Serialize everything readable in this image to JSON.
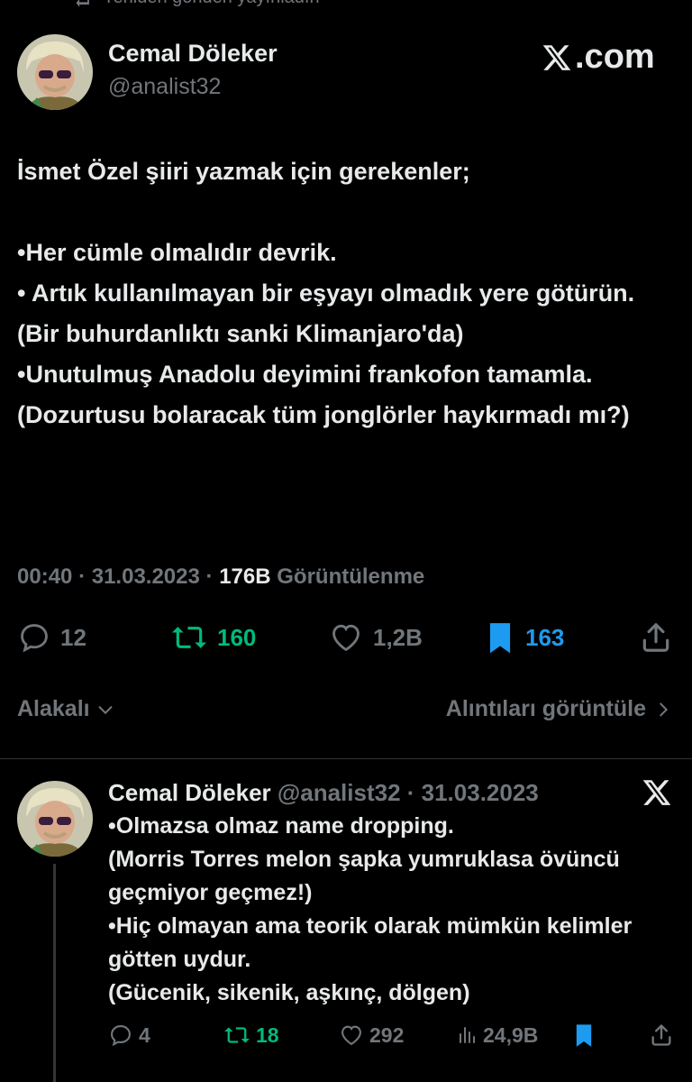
{
  "repost_notice": "Yeniden gönderi yayınladın",
  "branding": {
    "site": ".com"
  },
  "tweet": {
    "author_name": "Cemal Döleker",
    "author_handle": "@analist32",
    "lines": [
      "İsmet Özel şiiri yazmak için gerekenler;",
      "",
      "•Her cümle olmalıdır devrik.",
      "• Artık kullanılmayan bir eşyayı olmadık yere götürün. (Bir buhurdanlıktı sanki Klimanjaro'da)",
      "•Unutulmuş Anadolu deyimini frankofon tamamla. (Dozurtusu bolaracak tüm jonglörler haykırmadı mı?)"
    ],
    "time": "00:40",
    "date": "31.03.2023",
    "views_count": "176B",
    "views_label": "Görüntülenme",
    "replies": "12",
    "reposts": "160",
    "likes": "1,2B",
    "bookmarks": "163"
  },
  "subbar": {
    "sort_label": "Alakalı",
    "quotes_label": "Alıntıları görüntüle"
  },
  "reply": {
    "author_name": "Cemal Döleker",
    "author_handle": "@analist32",
    "date": "31.03.2023",
    "lines": [
      "•Olmazsa olmaz name dropping.",
      "(Morris Torres melon şapka yumruklasa övüncü geçmiyor geçmez!)",
      "•Hiç olmayan ama teorik olarak mümkün kelimler götten uydur.",
      "(Gücenik, sikenik, aşkınç, dölgen)"
    ],
    "replies": "4",
    "reposts": "18",
    "likes": "292",
    "views": "24,9B"
  },
  "colors": {
    "background": "#000000",
    "text": "#e7e9ea",
    "muted": "#71767b",
    "repost_green": "#00ba7c",
    "bookmark_blue": "#1d9bf0",
    "divider": "#2f3336"
  },
  "icons": [
    "repost-icon",
    "x-logo-icon",
    "reply-icon",
    "like-icon",
    "bookmark-icon",
    "share-icon",
    "chevron-down-icon",
    "chevron-right-icon",
    "views-icon"
  ]
}
